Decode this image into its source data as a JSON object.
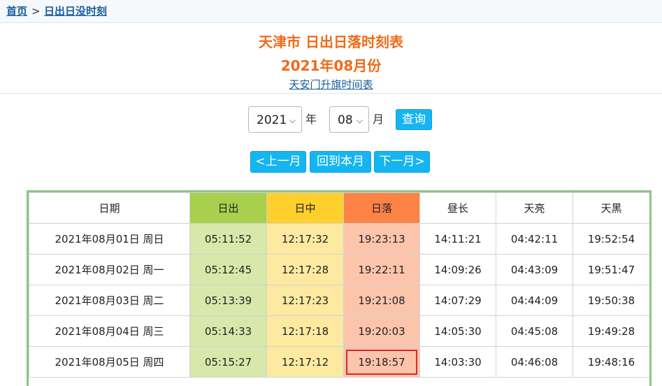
{
  "breadcrumb": {
    "home": "首页",
    "sep": ">",
    "current": "日出日没时刻"
  },
  "title": {
    "line1": "天津市 日出日落时刻表",
    "line2": "2021年08月份"
  },
  "flag_link": "天安门升旗时间表",
  "controls": {
    "year": "2021",
    "year_unit": "年",
    "month": "08",
    "month_unit": "月",
    "query": "查询",
    "prev": "<上一月",
    "current": "回到本月",
    "next": "下一月>"
  },
  "colors": {
    "accent": "#f06a19",
    "button": "#15b5f2",
    "sunrise": "#a8cf4d",
    "noon": "#ffd02b",
    "sunset": "#ff8345",
    "highlight": "#e02525"
  },
  "table": {
    "headers": [
      "日期",
      "日出",
      "日中",
      "日落",
      "昼长",
      "天亮",
      "天黑"
    ],
    "rows": [
      [
        "2021年08月01日 周日",
        "05:11:52",
        "12:17:32",
        "19:23:13",
        "14:11:21",
        "04:42:11",
        "19:52:54"
      ],
      [
        "2021年08月02日 周一",
        "05:12:45",
        "12:17:28",
        "19:22:11",
        "14:09:26",
        "04:43:09",
        "19:51:47"
      ],
      [
        "2021年08月03日 周二",
        "05:13:39",
        "12:17:23",
        "19:21:08",
        "14:07:29",
        "04:44:09",
        "19:50:38"
      ],
      [
        "2021年08月04日 周三",
        "05:14:33",
        "12:17:18",
        "19:20:03",
        "14:05:30",
        "04:45:08",
        "19:49:28"
      ],
      [
        "2021年08月05日 周四",
        "05:15:27",
        "12:17:12",
        "19:18:57",
        "14:03:30",
        "04:46:08",
        "19:48:16"
      ]
    ]
  }
}
